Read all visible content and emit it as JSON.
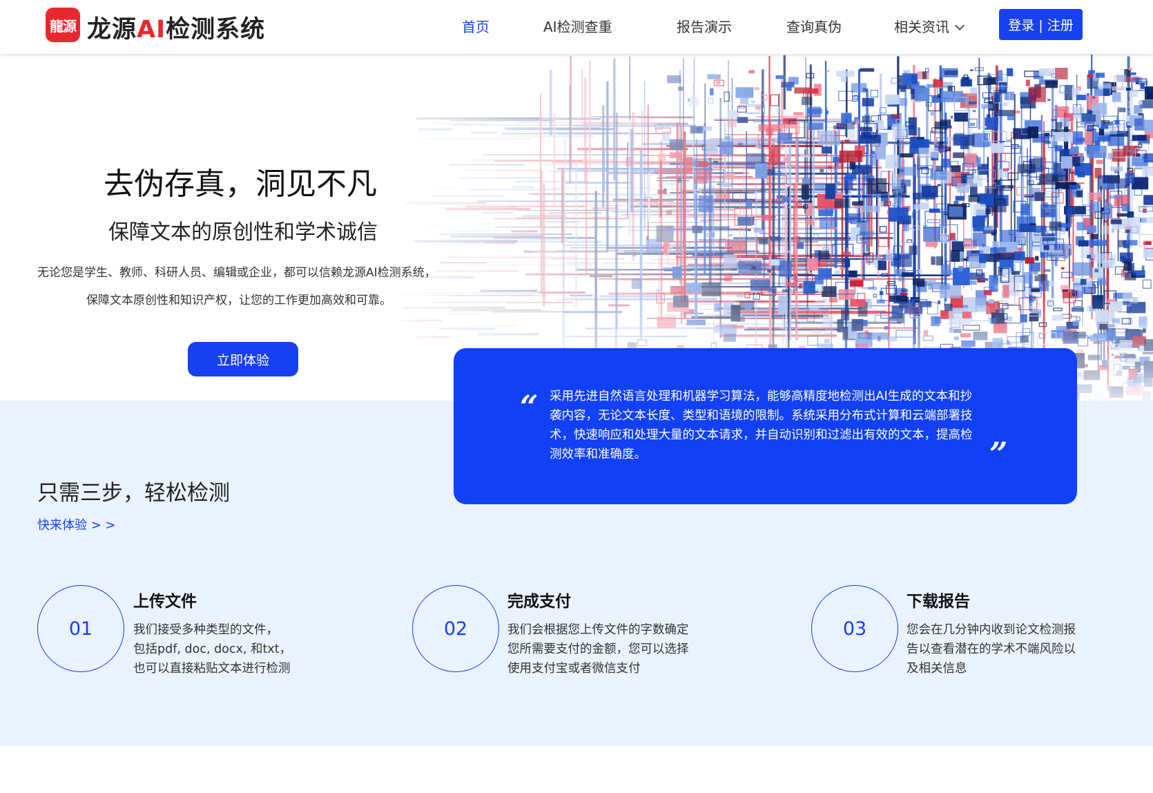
{
  "header": {
    "logo_mark": "龍源",
    "logo_name_pre": "龙源",
    "logo_name_ai": "AI",
    "logo_name_post": "检测系统",
    "nav": [
      {
        "label": "首页"
      },
      {
        "label": "AI检测查重"
      },
      {
        "label": "报告演示"
      },
      {
        "label": "查询真伪"
      },
      {
        "label": "相关资讯"
      }
    ],
    "login_label": "登录 | 注册"
  },
  "hero": {
    "title": "去伪存真，洞见不凡",
    "subtitle": "保障文本的原创性和学术诚信",
    "desc_line1": "无论您是学生、教师、科研人员、编辑或企业，都可以信赖龙源AI检测系统，",
    "desc_line2": "保障文本原创性和知识产权，让您的工作更加高效和可靠。",
    "cta": "立即体验"
  },
  "quote": {
    "open_mark": "“",
    "close_mark": "”",
    "text": "采用先进自然语言处理和机器学习算法，能够高精度地检测出AI生成的文本和抄袭内容，无论文本长度、类型和语境的限制。系统采用分布式计算和云端部署技术，快速响应和处理大量的文本请求，并自动识别和过滤出有效的文本，提高检测效率和准确度。"
  },
  "steps_section": {
    "title": "只需三步，轻松检测",
    "link": "快来体验 > >",
    "steps": [
      {
        "num": "01",
        "title": "上传文件",
        "lines": [
          "我们接受多种类型的文件，",
          "包括pdf, doc, docx, 和txt，",
          "也可以直接粘贴文本进行检测"
        ]
      },
      {
        "num": "02",
        "title": "完成支付",
        "lines": [
          "我们会根据您上传文件的字数确定",
          "您所需要支付的金额，您可以选择",
          "使用支付宝或者微信支付"
        ]
      },
      {
        "num": "03",
        "title": "下载报告",
        "lines": [
          "您会在几分钟内收到论文检测报",
          "告以查看潜在的学术不端风险以",
          "及相关信息"
        ]
      }
    ]
  },
  "colors": {
    "accent": "#1740f0",
    "logo_red": "#e8272e",
    "section_bg": "#eaf2fd"
  }
}
